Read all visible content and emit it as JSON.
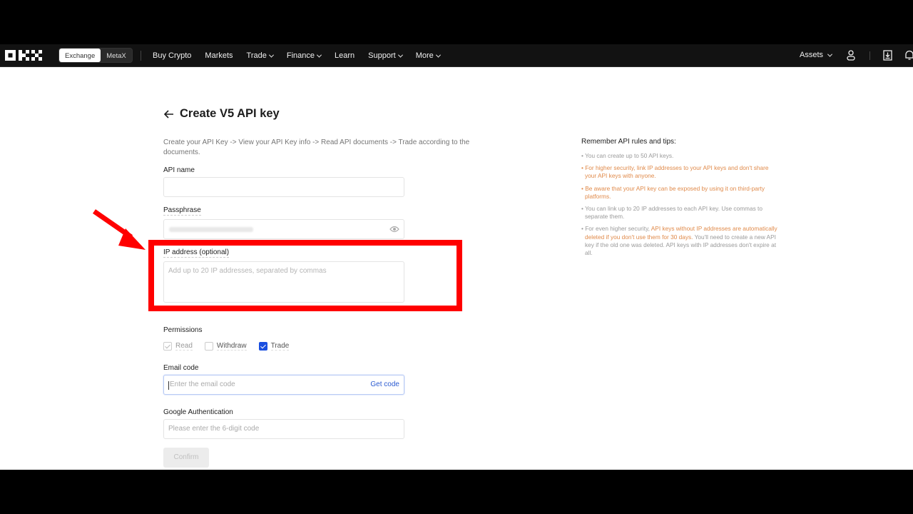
{
  "nav": {
    "logo": "OKX",
    "switch": [
      "Exchange",
      "MetaX"
    ],
    "items": [
      {
        "label": "Buy Crypto",
        "dropdown": false
      },
      {
        "label": "Markets",
        "dropdown": false
      },
      {
        "label": "Trade",
        "dropdown": true
      },
      {
        "label": "Finance",
        "dropdown": true
      },
      {
        "label": "Learn",
        "dropdown": false
      },
      {
        "label": "Support",
        "dropdown": true
      },
      {
        "label": "More",
        "dropdown": true
      }
    ],
    "assets_label": "Assets",
    "icons": [
      "user-icon",
      "download-icon",
      "bell-icon"
    ]
  },
  "page": {
    "title": "Create V5 API key",
    "steps": "Create your API Key -> View your API Key info -> Read API documents -> Trade according to the documents."
  },
  "form": {
    "api_name": {
      "label": "API name",
      "value": "",
      "placeholder": ""
    },
    "passphrase": {
      "label": "Passphrase",
      "value_masked": true
    },
    "ip": {
      "label": "IP address (optional)",
      "placeholder": "Add up to 20 IP addresses, separated by commas"
    },
    "permissions": {
      "label": "Permissions",
      "options": [
        {
          "label": "Read",
          "checked": true,
          "disabled": true
        },
        {
          "label": "Withdraw",
          "checked": false,
          "disabled": false
        },
        {
          "label": "Trade",
          "checked": true,
          "disabled": false
        }
      ]
    },
    "email": {
      "label": "Email code",
      "placeholder": "Enter the email code",
      "action": "Get code"
    },
    "google": {
      "label": "Google Authentication",
      "placeholder": "Please enter the 6-digit code"
    },
    "confirm_label": "Confirm"
  },
  "tips": {
    "title": "Remember API rules and tips:",
    "items": [
      {
        "text": "You can create up to 50 API keys.",
        "tone": "muted"
      },
      {
        "text": "For higher security, link IP addresses to your API keys and don't share your API keys with anyone.",
        "tone": "warn"
      },
      {
        "text": "Be aware that your API key can be exposed by using it on third-party platforms.",
        "tone": "warn"
      },
      {
        "text": "You can link up to 20 IP addresses to each API key. Use commas to separate them.",
        "tone": "muted"
      }
    ],
    "last": {
      "prefix": "For even higher security, ",
      "highlight": "API keys without IP addresses are automatically deleted if you don't use them for 30 days.",
      "suffix": " You'll need to create a new API key if the old one was deleted. API keys with IP addresses don't expire at all."
    }
  },
  "colors": {
    "accent": "#1a4fe0",
    "warn": "#e08a4a",
    "annotation": "#ff0000"
  }
}
